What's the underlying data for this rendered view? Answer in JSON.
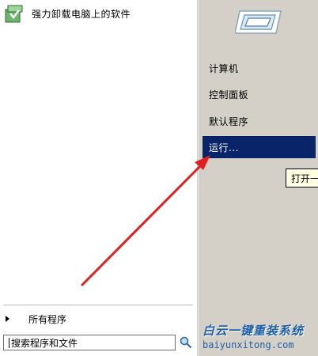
{
  "programs": [
    {
      "label": "强力卸载电脑上的软件",
      "icon": "uninstaller-icon"
    }
  ],
  "all_programs": {
    "label": "所有程序"
  },
  "search": {
    "placeholder": "搜索程序和文件",
    "value": ""
  },
  "right_menu": [
    {
      "label": "计算机"
    },
    {
      "label": "控制面板"
    },
    {
      "label": "默认程序"
    },
    {
      "label": "运行...",
      "selected": true
    }
  ],
  "tooltip": {
    "text": "打开一"
  },
  "watermark": {
    "title": "白云一键重装系统",
    "url": "baiyunxitong.com"
  },
  "colors": {
    "selection": "#0a246a",
    "right_pane": "#d4d0c8",
    "arrow": "#e02020",
    "watermark": "#1e5fa8"
  }
}
